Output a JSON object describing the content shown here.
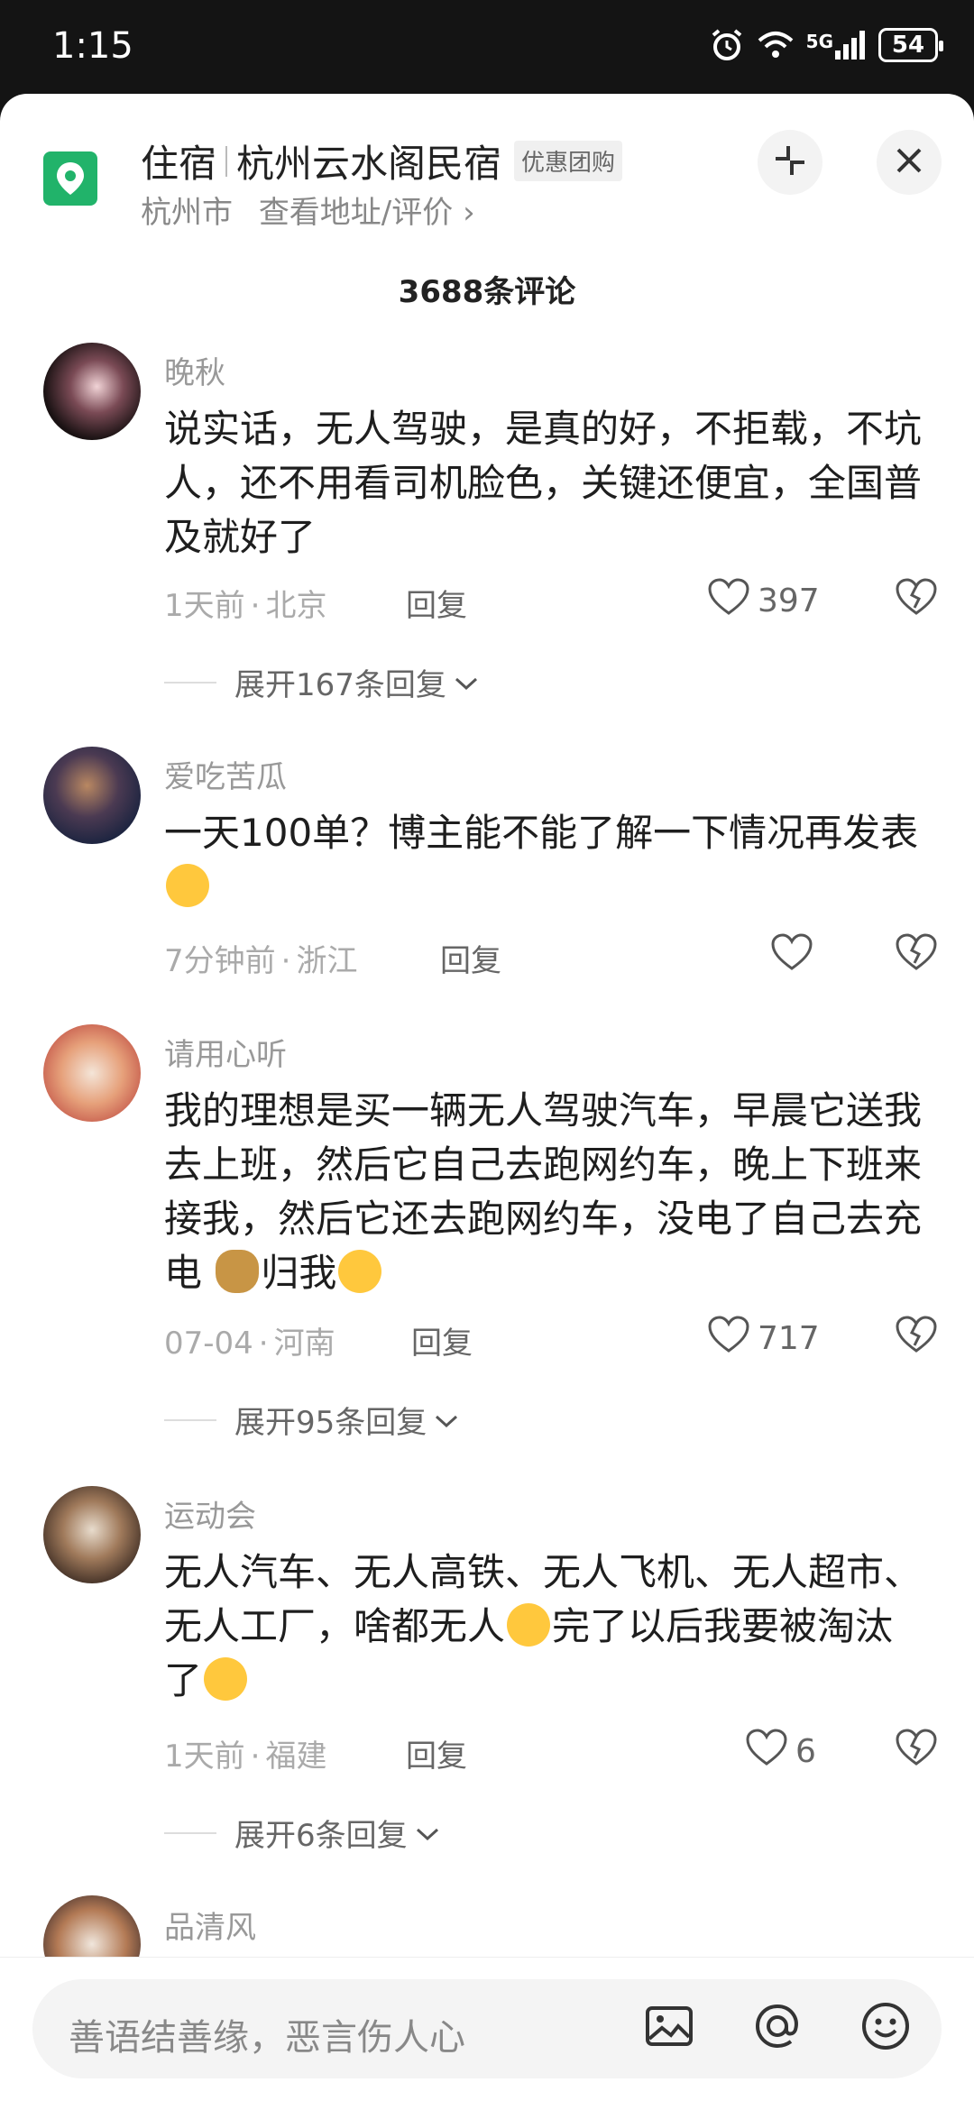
{
  "status": {
    "time": "1:15",
    "network": "5G",
    "battery": "54"
  },
  "poi": {
    "category": "住宿",
    "name": "杭州云水阁民宿",
    "tag": "优惠团购",
    "city": "杭州市",
    "link": "查看地址/评价 ›"
  },
  "comments_count": "3688条评论",
  "comments": [
    {
      "name": "晚秋",
      "text": "说实话，无人驾驶，是真的好，不拒载，不坑人，还不用看司机脸色，关键还便宜，全国普及就好了",
      "time": "1天前",
      "location": "北京",
      "reply": "回复",
      "likes": "397",
      "expand": "展开167条回复"
    },
    {
      "name": "爱吃苦瓜",
      "text": "一天100单？博主能不能了解一下情况再发表",
      "time": "7分钟前",
      "location": "浙江",
      "reply": "回复",
      "likes": ""
    },
    {
      "name": "请用心听",
      "text_a": "我的理想是买一辆无人驾驶汽车，早晨它送我去上班，然后它自己去跑网约车，晚上下班来接我，然后它还去跑网约车，没电了自己去充电 ",
      "text_b": "归我",
      "time": "07-04",
      "location": "河南",
      "reply": "回复",
      "likes": "717",
      "expand": "展开95条回复"
    },
    {
      "name": "运动会",
      "text_a": "无人汽车、无人高铁、无人飞机、无人超市、无人工厂，啥都无人",
      "text_b": "完了以后我要被淘汰了",
      "time": "1天前",
      "location": "福建",
      "reply": "回复",
      "likes": "6",
      "expand": "展开6条回复"
    },
    {
      "name": "品清风"
    }
  ],
  "input": {
    "placeholder": "善语结善缘，恶言伤人心"
  },
  "icons": {
    "alarm": "alarm-icon",
    "wifi": "wifi-icon",
    "signal": "signal-icon",
    "location": "location-pin-icon",
    "collapse": "collapse-icon",
    "close": "close-icon",
    "heart": "heart-icon",
    "dislike": "broken-heart-icon",
    "chevron": "chevron-down-icon",
    "image": "image-icon",
    "at": "at-icon",
    "emoji": "smiley-icon"
  },
  "colors": {
    "accent_green": "#21b36a"
  }
}
